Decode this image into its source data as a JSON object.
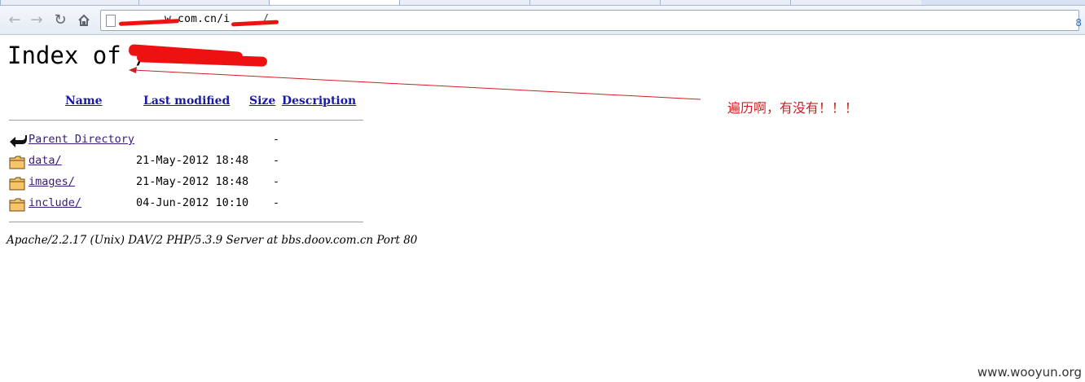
{
  "browser": {
    "url_prefix": "",
    "url_visible": "w.com.cn/i",
    "url_tail": "/",
    "right_glyph": "8"
  },
  "page": {
    "title_prefix": "Index of /",
    "columns": {
      "name": "Name",
      "last_modified": "Last modified",
      "size": "Size",
      "description": "Description"
    },
    "rows": [
      {
        "name": "Parent Directory",
        "modified": "",
        "size": "-",
        "icon": "back-arrow-icon"
      },
      {
        "name": "data/",
        "modified": "21-May-2012 18:48",
        "size": "-",
        "icon": "folder-icon"
      },
      {
        "name": "images/",
        "modified": "21-May-2012 18:48",
        "size": "-",
        "icon": "folder-icon"
      },
      {
        "name": "include/",
        "modified": "04-Jun-2012 10:10",
        "size": "-",
        "icon": "folder-icon"
      }
    ],
    "address": "Apache/2.2.17 (Unix) DAV/2 PHP/5.3.9 Server at bbs.doov.com.cn Port 80"
  },
  "annotation": {
    "text": "遍历啊，有没有！！！",
    "color": "#cc2020"
  },
  "watermark": "www.wooyun.org"
}
